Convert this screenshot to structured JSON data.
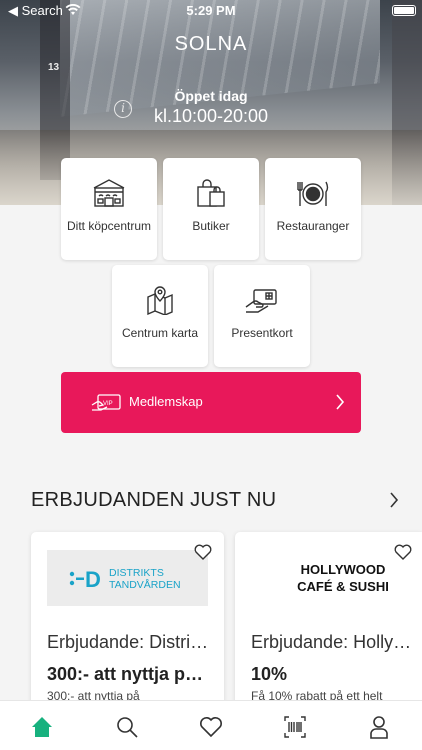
{
  "status_bar": {
    "back_label": "◀ Search",
    "time": "5:29 PM"
  },
  "header": {
    "center_name": "SOLNA",
    "open_title": "Öppet idag",
    "open_hours": "kl.10:00-20:00",
    "photo_sign": "13"
  },
  "tiles": [
    {
      "label": "Ditt köpcentrum",
      "icon": "mall-icon"
    },
    {
      "label": "Butiker",
      "icon": "shopping-bags-icon"
    },
    {
      "label": "Restauranger",
      "icon": "plate-cutlery-icon"
    },
    {
      "label": "Centrum karta",
      "icon": "map-pin-icon"
    },
    {
      "label": "Presentkort",
      "icon": "gift-card-icon"
    }
  ],
  "membership": {
    "label": "Medlemskap",
    "badge": "VIP",
    "color": "#e8185a"
  },
  "offers_section": {
    "title": "ERBJUDANDEN JUST NU"
  },
  "offers": [
    {
      "title": "Erbjudande: Distri…",
      "deal": "300:- att nyttja p…",
      "desc": "300:- att nyttja på",
      "logo": {
        "line1": "DISTRIKTS",
        "line2": "TANDVÅRDEN",
        "mark": "D"
      }
    },
    {
      "title": "Erbjudande: Holly…",
      "deal": "10%",
      "desc": "Få 10% rabatt på ett helt",
      "logo": {
        "line1": "HOLLYWOOD",
        "line2": "CAFÉ & SUSHI"
      }
    }
  ],
  "tabbar": {
    "active_color": "#17b17e",
    "items": [
      "home-icon",
      "search-icon",
      "heart-icon",
      "barcode-scanner-icon",
      "profile-icon"
    ]
  }
}
